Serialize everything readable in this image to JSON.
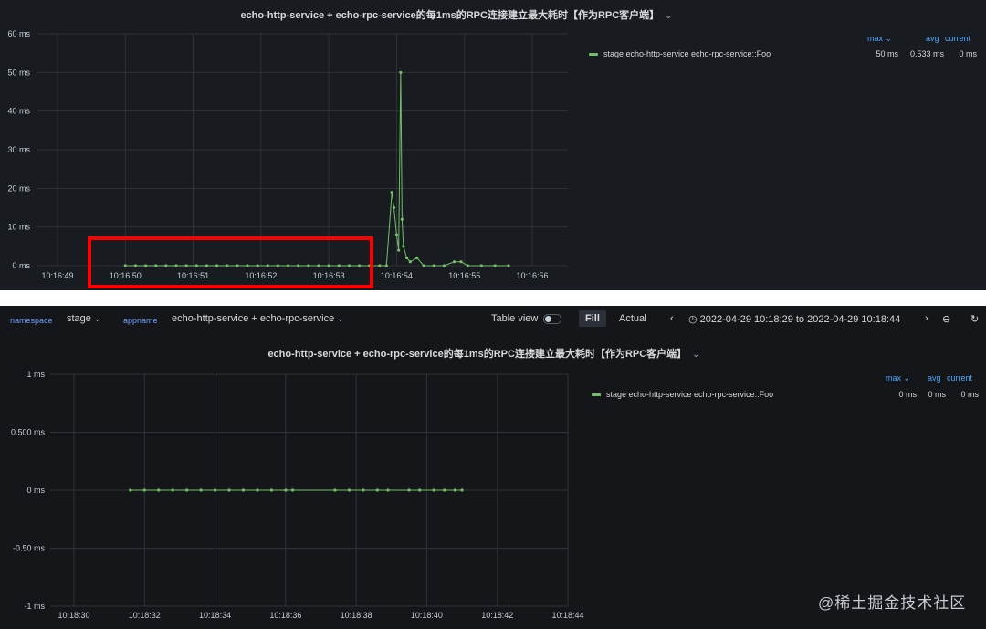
{
  "colors": {
    "series": "#73bf69",
    "grid": "#2f3238",
    "legend_header": "#4aa8ff",
    "annotation": "#ff0000"
  },
  "top_panel": {
    "title": "echo-http-service + echo-rpc-service的每1ms的RPC连接建立最大耗时【作为RPC客户端】",
    "legend": {
      "headers": {
        "max": "max",
        "avg": "avg",
        "current": "current"
      },
      "series_name": "stage echo-http-service echo-rpc-service::Foo",
      "max": "50 ms",
      "avg": "0.533 ms",
      "current": "0 ms"
    }
  },
  "toolbar": {
    "namespace_label": "namespace",
    "namespace_value": "stage",
    "appname_label": "appname",
    "appname_value": "echo-http-service + echo-rpc-service",
    "table_view_label": "Table view",
    "table_view_on": false,
    "fill_label": "Fill",
    "actual_label": "Actual",
    "time_range": "2022-04-29 10:18:29 to 2022-04-29 10:18:44",
    "icons": [
      "chevron-left-icon",
      "clock-icon",
      "chevron-right-icon",
      "zoom-out-icon",
      "refresh-icon"
    ]
  },
  "bottom_panel": {
    "title": "echo-http-service + echo-rpc-service的每1ms的RPC连接建立最大耗时【作为RPC客户端】",
    "legend": {
      "headers": {
        "max": "max",
        "avg": "avg",
        "current": "current"
      },
      "series_name": "stage echo-http-service echo-rpc-service::Foo",
      "max": "0 ms",
      "avg": "0 ms",
      "current": "0 ms"
    }
  },
  "watermark": "@稀土掘金技术社区",
  "chart_data": [
    {
      "type": "line",
      "x_unit": "time",
      "y_ticks": [
        "60 ms",
        "50 ms",
        "40 ms",
        "30 ms",
        "20 ms",
        "10 ms",
        "0 ms"
      ],
      "ylim": [
        0,
        60
      ],
      "x_ticks": [
        "10:16:49",
        "10:16:50",
        "10:16:51",
        "10:16:52",
        "10:16:53",
        "10:16:54",
        "10:16:55",
        "10:16:56"
      ],
      "grid": true,
      "series": [
        {
          "name": "stage echo-http-service echo-rpc-service::Foo",
          "points": [
            [
              "10:16:50.00",
              0
            ],
            [
              "10:16:50.15",
              0
            ],
            [
              "10:16:50.30",
              0
            ],
            [
              "10:16:50.45",
              0
            ],
            [
              "10:16:50.60",
              0
            ],
            [
              "10:16:50.75",
              0
            ],
            [
              "10:16:50.90",
              0
            ],
            [
              "10:16:51.05",
              0
            ],
            [
              "10:16:51.20",
              0
            ],
            [
              "10:16:51.35",
              0
            ],
            [
              "10:16:51.50",
              0
            ],
            [
              "10:16:51.65",
              0
            ],
            [
              "10:16:51.80",
              0
            ],
            [
              "10:16:51.95",
              0
            ],
            [
              "10:16:52.10",
              0
            ],
            [
              "10:16:52.25",
              0
            ],
            [
              "10:16:52.40",
              0
            ],
            [
              "10:16:52.55",
              0
            ],
            [
              "10:16:52.70",
              0
            ],
            [
              "10:16:52.85",
              0
            ],
            [
              "10:16:53.00",
              0
            ],
            [
              "10:16:53.15",
              0
            ],
            [
              "10:16:53.30",
              0
            ],
            [
              "10:16:53.45",
              0
            ],
            [
              "10:16:53.60",
              0
            ],
            [
              "10:16:53.75",
              0
            ],
            [
              "10:16:53.85",
              0
            ],
            [
              "10:16:53.93",
              19
            ],
            [
              "10:16:53.96",
              15
            ],
            [
              "10:16:54.00",
              8
            ],
            [
              "10:16:54.03",
              4
            ],
            [
              "10:16:54.06",
              50
            ],
            [
              "10:16:54.08",
              12
            ],
            [
              "10:16:54.10",
              5
            ],
            [
              "10:16:54.15",
              2
            ],
            [
              "10:16:54.20",
              1
            ],
            [
              "10:16:54.30",
              2
            ],
            [
              "10:16:54.40",
              0
            ],
            [
              "10:16:54.55",
              0
            ],
            [
              "10:16:54.70",
              0
            ],
            [
              "10:16:54.85",
              1
            ],
            [
              "10:16:54.95",
              1
            ],
            [
              "10:16:55.05",
              0
            ],
            [
              "10:16:55.25",
              0
            ],
            [
              "10:16:55.45",
              0
            ],
            [
              "10:16:55.65",
              0
            ]
          ]
        }
      ]
    },
    {
      "type": "line",
      "x_unit": "time",
      "y_ticks": [
        "1 ms",
        "0.500 ms",
        "0 ms",
        "-0.50 ms",
        "-1 ms"
      ],
      "ylim": [
        -1,
        1
      ],
      "x_ticks": [
        "10:18:30",
        "10:18:32",
        "10:18:34",
        "10:18:36",
        "10:18:38",
        "10:18:40",
        "10:18:42",
        "10:18:44"
      ],
      "grid": true,
      "series": [
        {
          "name": "stage echo-http-service echo-rpc-service::Foo",
          "points": [
            [
              "10:18:31.6",
              0
            ],
            [
              "10:18:32.0",
              0
            ],
            [
              "10:18:32.4",
              0
            ],
            [
              "10:18:32.8",
              0
            ],
            [
              "10:18:33.2",
              0
            ],
            [
              "10:18:33.6",
              0
            ],
            [
              "10:18:34.0",
              0
            ],
            [
              "10:18:34.4",
              0
            ],
            [
              "10:18:34.8",
              0
            ],
            [
              "10:18:35.2",
              0
            ],
            [
              "10:18:35.6",
              0
            ],
            [
              "10:18:36.0",
              0
            ],
            [
              "10:18:36.2",
              0
            ],
            [
              "10:18:37.4",
              0
            ],
            [
              "10:18:37.8",
              0
            ],
            [
              "10:18:38.2",
              0
            ],
            [
              "10:18:38.6",
              0
            ],
            [
              "10:18:38.9",
              0
            ],
            [
              "10:18:39.5",
              0
            ],
            [
              "10:18:39.8",
              0
            ],
            [
              "10:18:40.2",
              0
            ],
            [
              "10:18:40.5",
              0
            ],
            [
              "10:18:40.8",
              0
            ],
            [
              "10:18:41.0",
              0
            ]
          ]
        }
      ]
    }
  ]
}
